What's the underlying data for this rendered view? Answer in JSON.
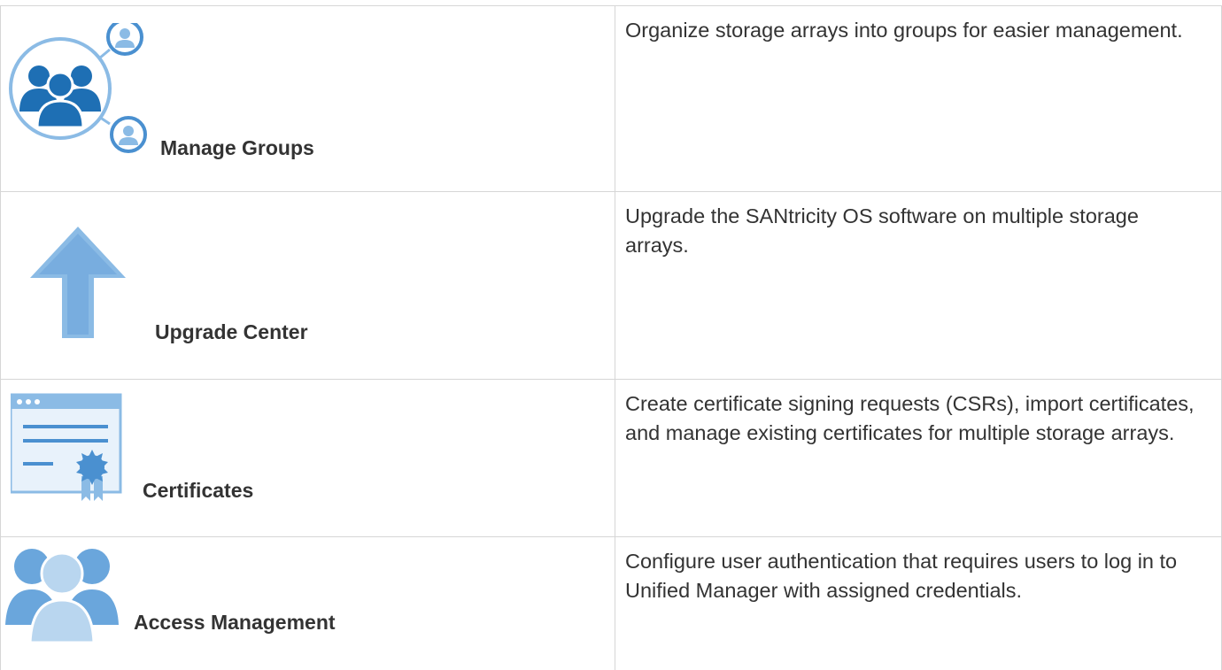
{
  "rows": [
    {
      "label": "Manage Groups",
      "icon": "group-network-icon",
      "description": "Organize storage arrays into groups for easier management."
    },
    {
      "label": "Upgrade Center",
      "icon": "up-arrow-icon",
      "description": "Upgrade the SANtricity OS software on multiple storage arrays."
    },
    {
      "label": "Certificates",
      "icon": "certificate-icon",
      "description": "Create certificate signing requests (CSRs), import certificates, and manage existing certificates for multiple storage arrays."
    },
    {
      "label": "Access Management",
      "icon": "users-icon",
      "description": "Configure user authentication that requires users to log in to Unified Manager with assigned credentials."
    }
  ],
  "colors": {
    "icon_dark": "#1e6fb4",
    "icon_mid": "#4a90d0",
    "icon_light": "#8bbbe5",
    "border": "#d6d6d6"
  }
}
